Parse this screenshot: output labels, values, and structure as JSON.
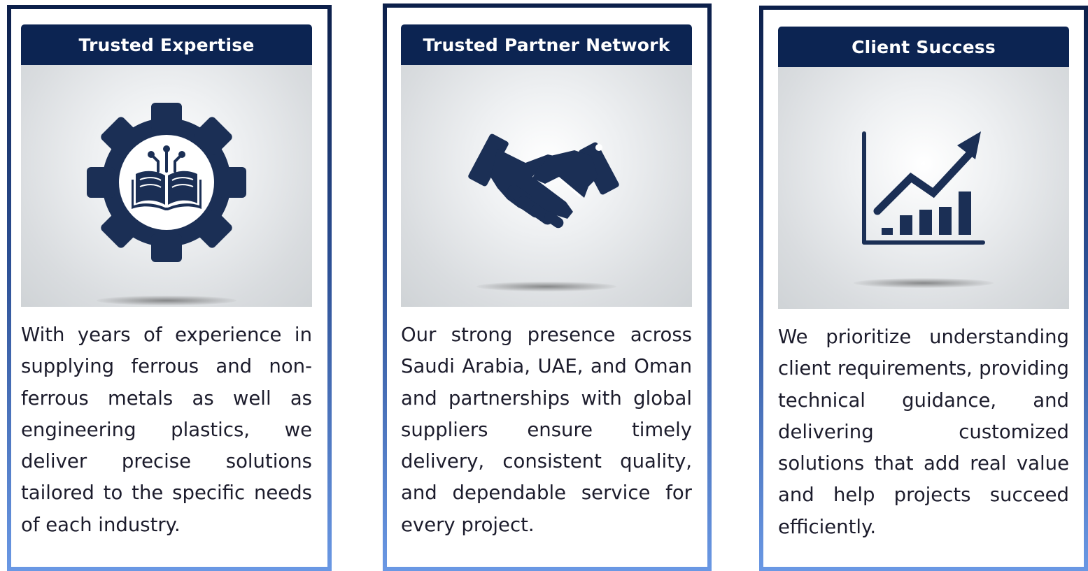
{
  "cards": [
    {
      "title": "Trusted Expertise",
      "icon": "gear-book-icon",
      "description": "With years of experience in supplying ferrous and non-ferrous metals as well as engineering plastics, we deliver precise solutions tailored to the specific needs of each industry."
    },
    {
      "title": "Trusted Partner Network",
      "icon": "handshake-icon",
      "description": "Our strong presence across Saudi Arabia, UAE, and Oman and partnerships with global suppliers ensure timely delivery, consistent quality, and dependable service for every project."
    },
    {
      "title": "Client Success",
      "icon": "growth-chart-icon",
      "description": "We prioritize understanding client requirements, providing technical guidance, and delivering customized solutions that add real value and help projects succeed efficiently."
    }
  ],
  "colors": {
    "header": "#0c2452",
    "icon": "#1b2f55",
    "border_top": "#0c1f4a",
    "border_bottom": "#6a98e4"
  }
}
